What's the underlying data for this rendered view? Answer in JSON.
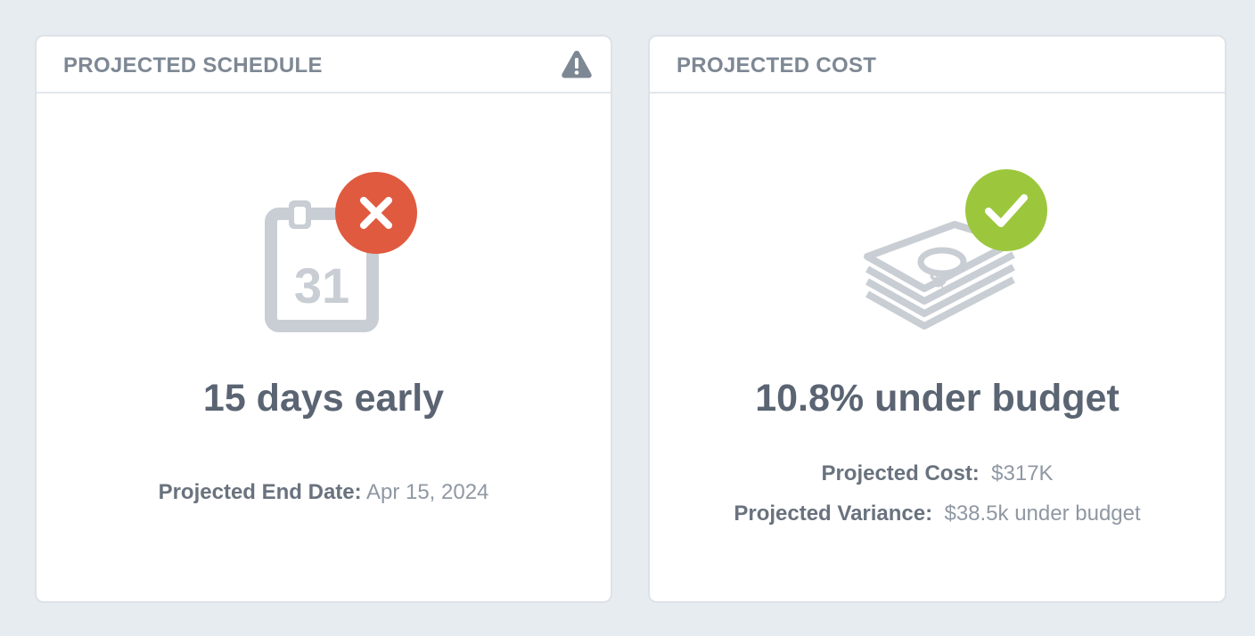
{
  "schedule": {
    "title": "PROJECTED SCHEDULE",
    "icon": "warning-icon",
    "calendar_day": "31",
    "status": "failed",
    "headline": "15 days early",
    "end_date_label": "Projected End Date:",
    "end_date_value": "Apr 15, 2024"
  },
  "cost": {
    "title": "PROJECTED COST",
    "status": "ok",
    "headline": "10.8% under budget",
    "cost_label": "Projected Cost:",
    "cost_value": "$317K",
    "variance_label": "Projected Variance:",
    "variance_value": "$38.5k under budget"
  },
  "colors": {
    "background": "#e7ecf0",
    "card": "#ffffff",
    "icon_gray": "#c9ced4",
    "error_red": "#e05a3f",
    "success_green": "#9cc73c",
    "headline_text": "#5a6472"
  }
}
